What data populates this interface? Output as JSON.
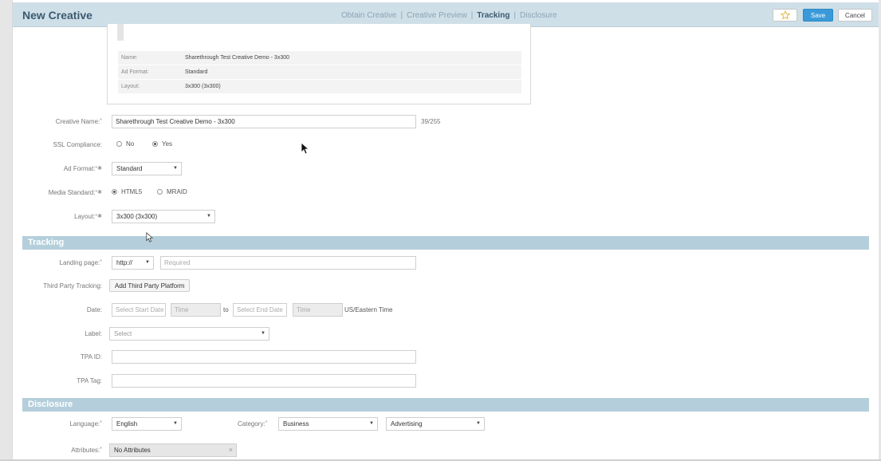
{
  "header": {
    "title": "New Creative",
    "steps": [
      "Obtain Creative",
      "Creative Preview",
      "Tracking",
      "Disclosure"
    ],
    "active_step": "Tracking",
    "save_label": "Save",
    "cancel_label": "Cancel"
  },
  "summary": {
    "rows": [
      {
        "key": "Name:",
        "value": "Sharethrough Test Creative Demo - 3x300"
      },
      {
        "key": "Ad Format:",
        "value": "Standard"
      },
      {
        "key": "Layout:",
        "value": "3x300 (3x300)"
      }
    ]
  },
  "creative": {
    "name_label": "Creative Name:",
    "name_value": "Sharethrough Test Creative Demo - 3x300",
    "name_counter": "39/255",
    "ssl_label": "SSL Compliance:",
    "ssl_no": "No",
    "ssl_yes": "Yes",
    "ad_format_label": "Ad Format:",
    "ad_format_value": "Standard",
    "media_standard_label": "Media Standard:",
    "media_html5": "HTML5",
    "media_mraid": "MRAID",
    "layout_label": "Layout:",
    "layout_value": "3x300 (3x300)"
  },
  "tracking": {
    "section_title": "Tracking",
    "landing_label": "Landing page:",
    "protocol_value": "http://",
    "landing_placeholder": "Required",
    "third_party_label": "Third Party Tracking:",
    "add_platform_label": "Add Third Party Platform",
    "date_label": "Date:",
    "start_date_placeholder": "Select Start Date",
    "start_time_placeholder": "Time",
    "to_text": "to",
    "end_date_placeholder": "Select End Date",
    "end_time_placeholder": "Time",
    "timezone": "US/Eastern Time",
    "label_label": "Label:",
    "label_placeholder": "Select",
    "tpa_id_label": "TPA ID:",
    "tpa_tag_label": "TPA Tag:"
  },
  "disclosure": {
    "section_title": "Disclosure",
    "language_label": "Language:",
    "language_value": "English",
    "category_label": "Category:",
    "category_value": "Business",
    "subcategory_value": "Advertising",
    "attributes_label": "Attributes:",
    "attributes_value": "No Attributes"
  },
  "icons": {
    "star": "star-icon",
    "cursor": "mouse-pointer-icon",
    "caret": "caret-down-icon",
    "remove": "close-icon"
  }
}
